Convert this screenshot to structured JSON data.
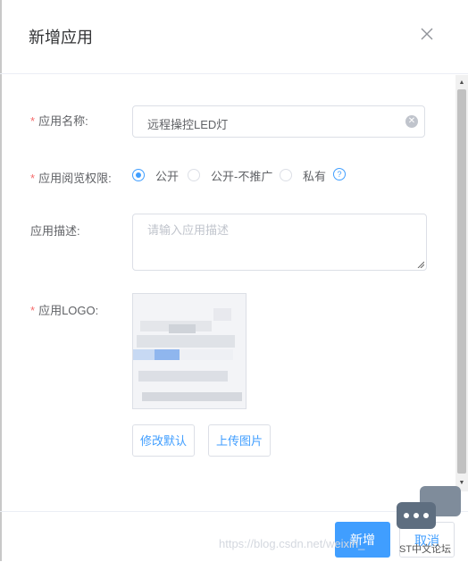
{
  "dialog": {
    "title": "新增应用",
    "close_icon": "close-icon"
  },
  "form": {
    "name": {
      "label": "应用名称:",
      "value": "远程操控LED灯",
      "required_mark": "*"
    },
    "permission": {
      "label": "应用阅览权限:",
      "required_mark": "*",
      "options": [
        "公开",
        "公开-不推广",
        "私有"
      ],
      "selected": "公开",
      "help_icon": "question-circle-icon"
    },
    "description": {
      "label": "应用描述:",
      "placeholder": "请输入应用描述"
    },
    "logo": {
      "label": "应用LOGO:",
      "required_mark": "*",
      "buttons": {
        "reset": "修改默认",
        "upload": "上传图片"
      }
    }
  },
  "footer": {
    "confirm": "新增",
    "cancel": "取消",
    "watermark": "https://blog.csdn.net/weixin_",
    "forum_label": "ST中文论坛"
  },
  "colors": {
    "primary": "#409eff",
    "required": "#f56c6c",
    "border": "#dcdfe6",
    "text": "#606266"
  }
}
